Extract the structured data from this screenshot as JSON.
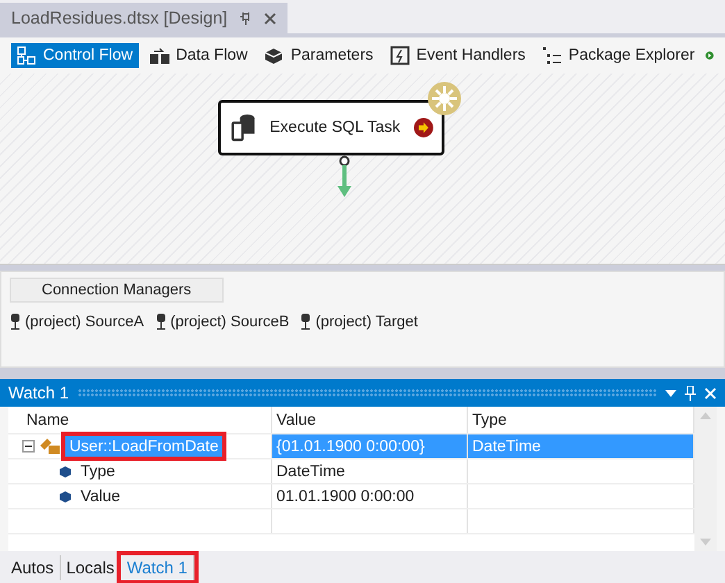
{
  "document_tab": {
    "title": "LoadResidues.dtsx [Design]"
  },
  "designer_tabs": [
    {
      "label": "Control Flow",
      "selected": true
    },
    {
      "label": "Data Flow",
      "selected": false
    },
    {
      "label": "Parameters",
      "selected": false
    },
    {
      "label": "Event Handlers",
      "selected": false
    },
    {
      "label": "Package Explorer",
      "selected": false
    }
  ],
  "task": {
    "label": "Execute SQL Task"
  },
  "connection_managers": {
    "title": "Connection Managers",
    "items": [
      "(project) SourceA",
      "(project) SourceB",
      "(project) Target"
    ]
  },
  "watch": {
    "title": "Watch 1",
    "columns": [
      "Name",
      "Value",
      "Type"
    ],
    "rows": [
      {
        "name": "User::LoadFromDate",
        "value": "{01.01.1900 0:00:00}",
        "type": "DateTime",
        "selected": true,
        "expanded": true,
        "highlighted": true,
        "children": [
          {
            "name": "Type",
            "value": "DateTime",
            "selected": false,
            "highlighted": false
          },
          {
            "name": "Value",
            "value": "01.01.1900 0:00:00",
            "selected": false,
            "highlighted": false
          }
        ]
      }
    ]
  },
  "bottom_tabs": [
    {
      "label": "Autos",
      "selected": false,
      "highlighted": false
    },
    {
      "label": "Locals",
      "selected": false,
      "highlighted": false
    },
    {
      "label": "Watch 1",
      "selected": true,
      "highlighted": true
    }
  ]
}
